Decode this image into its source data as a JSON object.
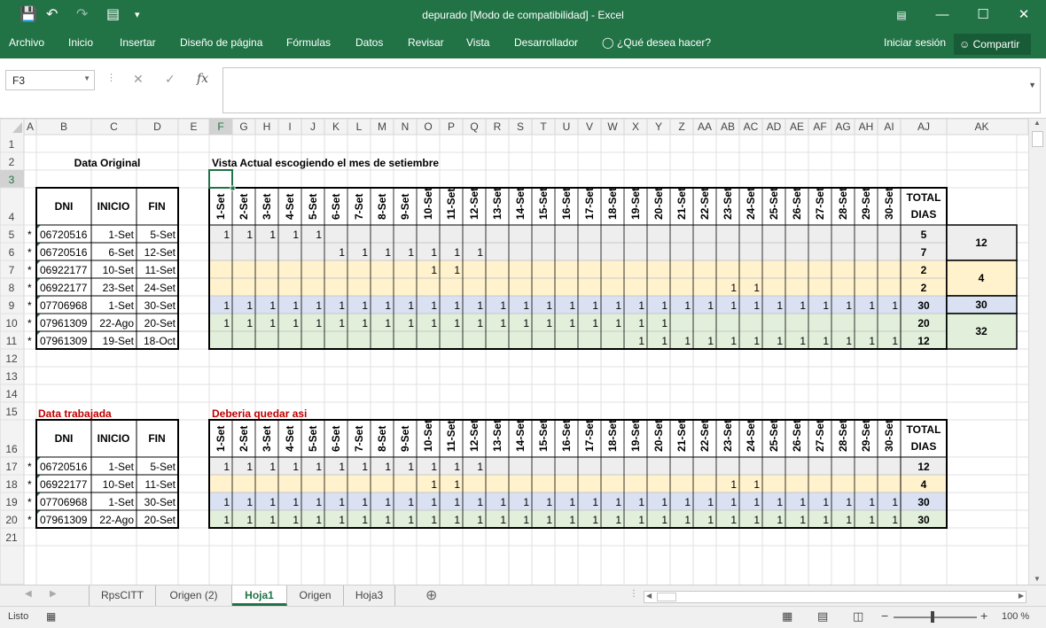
{
  "window": {
    "title": "depurado  [Modo de compatibilidad] - Excel"
  },
  "ribbon": {
    "tabs": [
      "Archivo",
      "Inicio",
      "Insertar",
      "Diseño de página",
      "Fórmulas",
      "Datos",
      "Revisar",
      "Vista",
      "Desarrollador"
    ],
    "tell_me": "¿Qué desea hacer?",
    "signin": "Iniciar sesión",
    "share": "Compartir"
  },
  "formula_bar": {
    "name_box": "F3",
    "formula": ""
  },
  "grid": {
    "columns": [
      "A",
      "B",
      "C",
      "D",
      "E",
      "F",
      "G",
      "H",
      "I",
      "J",
      "K",
      "L",
      "M",
      "N",
      "O",
      "P",
      "Q",
      "R",
      "S",
      "T",
      "U",
      "V",
      "W",
      "X",
      "Y",
      "Z",
      "AA",
      "AB",
      "AC",
      "AD",
      "AE",
      "AF",
      "AG",
      "AH",
      "AI",
      "AJ",
      "AK"
    ],
    "rows": [
      "1",
      "2",
      "3",
      "4",
      "5",
      "6",
      "7",
      "8",
      "9",
      "10",
      "11",
      "12",
      "13",
      "14",
      "15",
      "16",
      "17",
      "18",
      "19",
      "20",
      "21"
    ],
    "days": [
      "1-Set",
      "2-Set",
      "3-Set",
      "4-Set",
      "5-Set",
      "6-Set",
      "7-Set",
      "8-Set",
      "9-Set",
      "10-Set",
      "11-Set",
      "12-Set",
      "13-Set",
      "14-Set",
      "15-Set",
      "16-Set",
      "17-Set",
      "18-Set",
      "19-Set",
      "20-Set",
      "21-Set",
      "22-Set",
      "23-Set",
      "24-Set",
      "25-Set",
      "26-Set",
      "27-Set",
      "28-Set",
      "29-Set",
      "30-Set"
    ],
    "header_dni": "DNI",
    "header_inicio": "INICIO",
    "header_fin": "FIN",
    "header_total": "TOTAL DIAS",
    "marker": "*",
    "colors": {
      "gray": "#eeeeee",
      "yellow": "#fff2cc",
      "blue": "#d9e1f2",
      "green": "#e2efda",
      "red": "#c00000",
      "border": "#000000"
    },
    "top": {
      "title_left": "Data Original",
      "title_right": "Vista Actual escogiendo el mes de setiembre",
      "records": [
        {
          "dni": "06720516",
          "inicio": "1-Set",
          "fin": "5-Set",
          "from": 1,
          "to": 5,
          "total": "5",
          "color": "gray"
        },
        {
          "dni": "06720516",
          "inicio": "6-Set",
          "fin": "12-Set",
          "from": 6,
          "to": 12,
          "total": "7",
          "color": "gray"
        },
        {
          "dni": "06922177",
          "inicio": "10-Set",
          "fin": "11-Set",
          "from": 10,
          "to": 11,
          "total": "2",
          "color": "yellow"
        },
        {
          "dni": "06922177",
          "inicio": "23-Set",
          "fin": "24-Set",
          "from": 23,
          "to": 24,
          "total": "2",
          "color": "yellow"
        },
        {
          "dni": "07706968",
          "inicio": "1-Set",
          "fin": "30-Set",
          "from": 1,
          "to": 30,
          "total": "30",
          "color": "blue"
        },
        {
          "dni": "07961309",
          "inicio": "22-Ago",
          "fin": "20-Set",
          "from": 1,
          "to": 20,
          "total": "20",
          "color": "green"
        },
        {
          "dni": "07961309",
          "inicio": "19-Set",
          "fin": "18-Oct",
          "from": 19,
          "to": 30,
          "total": "12",
          "color": "green"
        }
      ],
      "sums": [
        {
          "value": "12",
          "start": 0,
          "span": 2,
          "color": "gray"
        },
        {
          "value": "4",
          "start": 2,
          "span": 2,
          "color": "yellow"
        },
        {
          "value": "30",
          "start": 4,
          "span": 1,
          "color": "blue"
        },
        {
          "value": "32",
          "start": 5,
          "span": 2,
          "color": "green"
        }
      ]
    },
    "bottom": {
      "title_left": "Data trabajada",
      "title_right": "Deberia quedar asi",
      "records": [
        {
          "dni": "06720516",
          "inicio": "1-Set",
          "fin": "5-Set",
          "ranges": [
            [
              1,
              12
            ]
          ],
          "total": "12",
          "color": "gray"
        },
        {
          "dni": "06922177",
          "inicio": "10-Set",
          "fin": "11-Set",
          "ranges": [
            [
              10,
              11
            ],
            [
              23,
              24
            ]
          ],
          "total": "4",
          "color": "yellow"
        },
        {
          "dni": "07706968",
          "inicio": "1-Set",
          "fin": "30-Set",
          "ranges": [
            [
              1,
              30
            ]
          ],
          "total": "30",
          "color": "blue"
        },
        {
          "dni": "07961309",
          "inicio": "22-Ago",
          "fin": "20-Set",
          "ranges": [
            [
              1,
              30
            ]
          ],
          "total": "30",
          "color": "green"
        }
      ]
    }
  },
  "sheet_tabs": [
    "RpsCITT",
    "Origen (2)",
    "Hoja1",
    "Origen",
    "Hoja3"
  ],
  "active_sheet": "Hoja1",
  "status": {
    "ready": "Listo",
    "zoom": "100 %"
  }
}
